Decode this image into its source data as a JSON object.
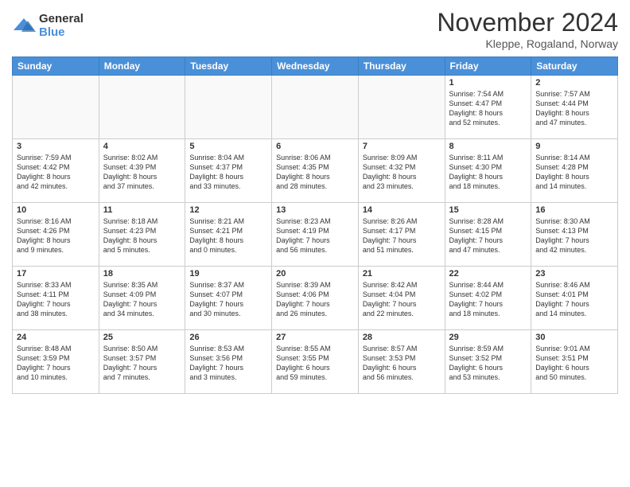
{
  "logo": {
    "general": "General",
    "blue": "Blue"
  },
  "title": "November 2024",
  "subtitle": "Kleppe, Rogaland, Norway",
  "days_header": [
    "Sunday",
    "Monday",
    "Tuesday",
    "Wednesday",
    "Thursday",
    "Friday",
    "Saturday"
  ],
  "weeks": [
    [
      {
        "day": "",
        "info": ""
      },
      {
        "day": "",
        "info": ""
      },
      {
        "day": "",
        "info": ""
      },
      {
        "day": "",
        "info": ""
      },
      {
        "day": "",
        "info": ""
      },
      {
        "day": "1",
        "info": "Sunrise: 7:54 AM\nSunset: 4:47 PM\nDaylight: 8 hours\nand 52 minutes."
      },
      {
        "day": "2",
        "info": "Sunrise: 7:57 AM\nSunset: 4:44 PM\nDaylight: 8 hours\nand 47 minutes."
      }
    ],
    [
      {
        "day": "3",
        "info": "Sunrise: 7:59 AM\nSunset: 4:42 PM\nDaylight: 8 hours\nand 42 minutes."
      },
      {
        "day": "4",
        "info": "Sunrise: 8:02 AM\nSunset: 4:39 PM\nDaylight: 8 hours\nand 37 minutes."
      },
      {
        "day": "5",
        "info": "Sunrise: 8:04 AM\nSunset: 4:37 PM\nDaylight: 8 hours\nand 33 minutes."
      },
      {
        "day": "6",
        "info": "Sunrise: 8:06 AM\nSunset: 4:35 PM\nDaylight: 8 hours\nand 28 minutes."
      },
      {
        "day": "7",
        "info": "Sunrise: 8:09 AM\nSunset: 4:32 PM\nDaylight: 8 hours\nand 23 minutes."
      },
      {
        "day": "8",
        "info": "Sunrise: 8:11 AM\nSunset: 4:30 PM\nDaylight: 8 hours\nand 18 minutes."
      },
      {
        "day": "9",
        "info": "Sunrise: 8:14 AM\nSunset: 4:28 PM\nDaylight: 8 hours\nand 14 minutes."
      }
    ],
    [
      {
        "day": "10",
        "info": "Sunrise: 8:16 AM\nSunset: 4:26 PM\nDaylight: 8 hours\nand 9 minutes."
      },
      {
        "day": "11",
        "info": "Sunrise: 8:18 AM\nSunset: 4:23 PM\nDaylight: 8 hours\nand 5 minutes."
      },
      {
        "day": "12",
        "info": "Sunrise: 8:21 AM\nSunset: 4:21 PM\nDaylight: 8 hours\nand 0 minutes."
      },
      {
        "day": "13",
        "info": "Sunrise: 8:23 AM\nSunset: 4:19 PM\nDaylight: 7 hours\nand 56 minutes."
      },
      {
        "day": "14",
        "info": "Sunrise: 8:26 AM\nSunset: 4:17 PM\nDaylight: 7 hours\nand 51 minutes."
      },
      {
        "day": "15",
        "info": "Sunrise: 8:28 AM\nSunset: 4:15 PM\nDaylight: 7 hours\nand 47 minutes."
      },
      {
        "day": "16",
        "info": "Sunrise: 8:30 AM\nSunset: 4:13 PM\nDaylight: 7 hours\nand 42 minutes."
      }
    ],
    [
      {
        "day": "17",
        "info": "Sunrise: 8:33 AM\nSunset: 4:11 PM\nDaylight: 7 hours\nand 38 minutes."
      },
      {
        "day": "18",
        "info": "Sunrise: 8:35 AM\nSunset: 4:09 PM\nDaylight: 7 hours\nand 34 minutes."
      },
      {
        "day": "19",
        "info": "Sunrise: 8:37 AM\nSunset: 4:07 PM\nDaylight: 7 hours\nand 30 minutes."
      },
      {
        "day": "20",
        "info": "Sunrise: 8:39 AM\nSunset: 4:06 PM\nDaylight: 7 hours\nand 26 minutes."
      },
      {
        "day": "21",
        "info": "Sunrise: 8:42 AM\nSunset: 4:04 PM\nDaylight: 7 hours\nand 22 minutes."
      },
      {
        "day": "22",
        "info": "Sunrise: 8:44 AM\nSunset: 4:02 PM\nDaylight: 7 hours\nand 18 minutes."
      },
      {
        "day": "23",
        "info": "Sunrise: 8:46 AM\nSunset: 4:01 PM\nDaylight: 7 hours\nand 14 minutes."
      }
    ],
    [
      {
        "day": "24",
        "info": "Sunrise: 8:48 AM\nSunset: 3:59 PM\nDaylight: 7 hours\nand 10 minutes."
      },
      {
        "day": "25",
        "info": "Sunrise: 8:50 AM\nSunset: 3:57 PM\nDaylight: 7 hours\nand 7 minutes."
      },
      {
        "day": "26",
        "info": "Sunrise: 8:53 AM\nSunset: 3:56 PM\nDaylight: 7 hours\nand 3 minutes."
      },
      {
        "day": "27",
        "info": "Sunrise: 8:55 AM\nSunset: 3:55 PM\nDaylight: 6 hours\nand 59 minutes."
      },
      {
        "day": "28",
        "info": "Sunrise: 8:57 AM\nSunset: 3:53 PM\nDaylight: 6 hours\nand 56 minutes."
      },
      {
        "day": "29",
        "info": "Sunrise: 8:59 AM\nSunset: 3:52 PM\nDaylight: 6 hours\nand 53 minutes."
      },
      {
        "day": "30",
        "info": "Sunrise: 9:01 AM\nSunset: 3:51 PM\nDaylight: 6 hours\nand 50 minutes."
      }
    ]
  ]
}
